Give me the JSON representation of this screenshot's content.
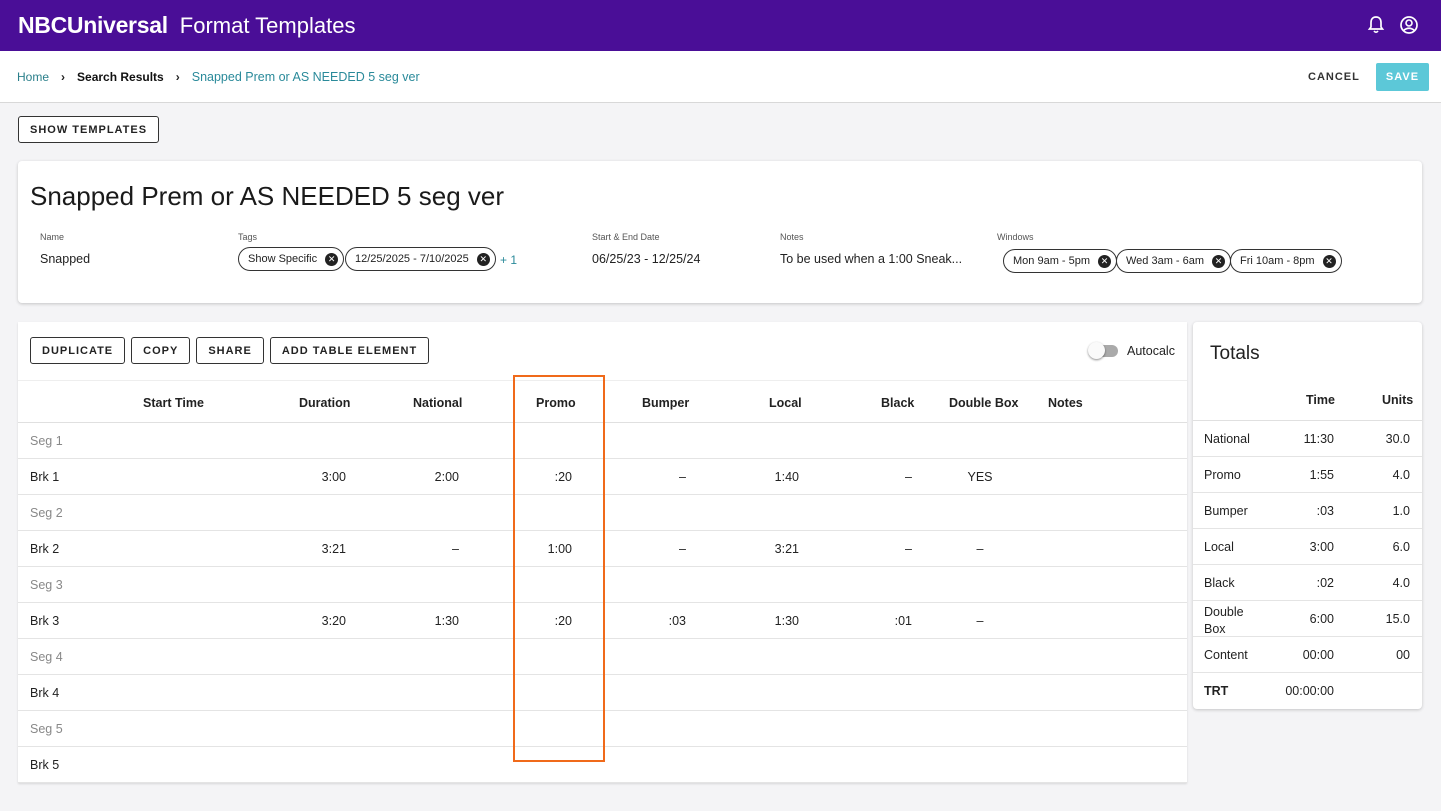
{
  "app": {
    "brand": "NBCUniversal",
    "title": "Format Templates"
  },
  "breadcrumb": {
    "home": "Home",
    "search": "Search Results",
    "current": "Snapped Prem or AS NEEDED 5 seg ver"
  },
  "actions": {
    "cancel": "CANCEL",
    "save": "SAVE",
    "show_templates": "SHOW TEMPLATES"
  },
  "header": {
    "title": "Snapped Prem or AS NEEDED 5 seg ver",
    "name_label": "Name",
    "name_value": "Snapped",
    "tags_label": "Tags",
    "tags": [
      "Show Specific",
      "12/25/2025 - 7/10/2025"
    ],
    "tags_more": "+ 1",
    "dates_label": "Start & End Date",
    "dates_value": "06/25/23 - 12/25/24",
    "notes_label": "Notes",
    "notes_value": "To be used when a 1:00 Sneak...",
    "windows_label": "Windows",
    "windows": [
      "Mon 9am - 5pm",
      "Wed 3am - 6am",
      "Fri 10am - 8pm"
    ]
  },
  "toolbar": {
    "duplicate": "DUPLICATE",
    "copy": "COPY",
    "share": "SHARE",
    "add": "ADD TABLE ELEMENT",
    "autocalc": "Autocalc"
  },
  "table": {
    "columns": [
      "Start Time",
      "Duration",
      "National",
      "Promo",
      "Bumper",
      "Local",
      "Black",
      "Double Box",
      "Notes"
    ],
    "rows": [
      {
        "label": "Seg 1",
        "type": "seg",
        "cells": [
          "",
          "",
          "",
          "",
          "",
          "",
          "",
          ""
        ]
      },
      {
        "label": "Brk 1",
        "type": "brk",
        "cells": [
          "3:00",
          "2:00",
          ":20",
          "–",
          "1:40",
          "–",
          "YES",
          ""
        ]
      },
      {
        "label": "Seg 2",
        "type": "seg",
        "cells": [
          "",
          "",
          "",
          "",
          "",
          "",
          "",
          ""
        ]
      },
      {
        "label": "Brk 2",
        "type": "brk",
        "cells": [
          "3:21",
          "–",
          "1:00",
          "–",
          "3:21",
          "–",
          "–",
          ""
        ]
      },
      {
        "label": "Seg 3",
        "type": "seg",
        "cells": [
          "",
          "",
          "",
          "",
          "",
          "",
          "",
          ""
        ]
      },
      {
        "label": "Brk 3",
        "type": "brk",
        "cells": [
          "3:20",
          "1:30",
          ":20",
          ":03",
          "1:30",
          ":01",
          "–",
          ""
        ]
      },
      {
        "label": "Seg 4",
        "type": "seg",
        "cells": [
          "",
          "",
          "",
          "",
          "",
          "",
          "",
          ""
        ]
      },
      {
        "label": "Brk 4",
        "type": "brk",
        "cells": [
          "",
          "",
          "",
          "",
          "",
          "",
          "",
          ""
        ]
      },
      {
        "label": "Seg 5",
        "type": "seg",
        "cells": [
          "",
          "",
          "",
          "",
          "",
          "",
          "",
          ""
        ]
      },
      {
        "label": "Brk 5",
        "type": "brk",
        "cells": [
          "",
          "",
          "",
          "",
          "",
          "",
          "",
          ""
        ]
      }
    ]
  },
  "totals": {
    "title": "Totals",
    "time_header": "Time",
    "units_header": "Units",
    "rows": [
      {
        "label": "National",
        "time": "11:30",
        "units": "30.0"
      },
      {
        "label": "Promo",
        "time": "1:55",
        "units": "4.0"
      },
      {
        "label": "Bumper",
        "time": ":03",
        "units": "1.0"
      },
      {
        "label": "Local",
        "time": "3:00",
        "units": "6.0"
      },
      {
        "label": "Black",
        "time": ":02",
        "units": "4.0"
      },
      {
        "label": "Double Box",
        "time": "6:00",
        "units": "15.0"
      },
      {
        "label": "Content",
        "time": "00:00",
        "units": "00"
      },
      {
        "label": "TRT",
        "time": "00:00:00",
        "units": ""
      }
    ]
  },
  "colors": {
    "topbar": "#4a0e97",
    "accent": "#2a8a9a",
    "save": "#5cc8d8",
    "highlight": "#f06a1a"
  }
}
